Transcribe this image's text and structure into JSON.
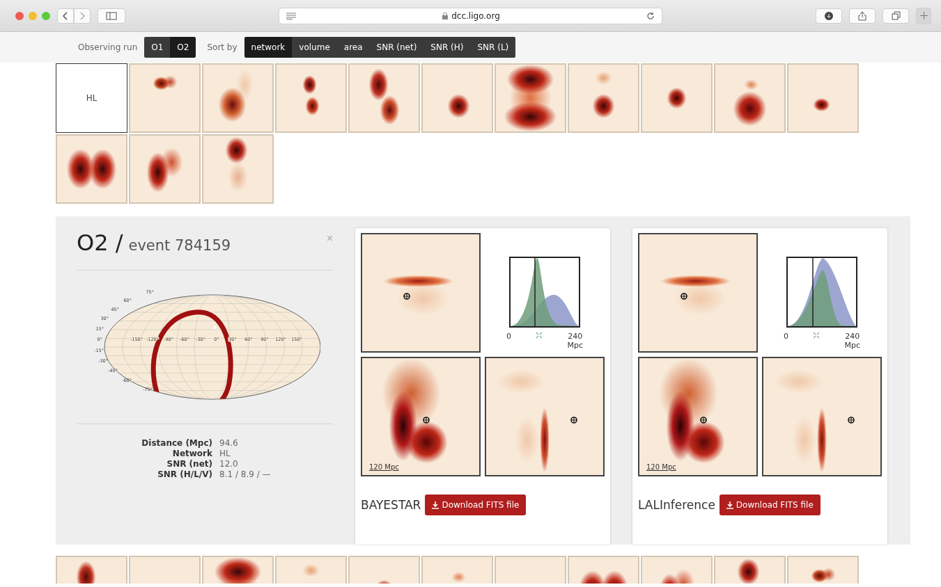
{
  "browser": {
    "url": "dcc.ligo.org"
  },
  "filters": {
    "run_label": "Observing run",
    "runs": [
      {
        "label": "O1",
        "selected": false
      },
      {
        "label": "O2",
        "selected": true
      }
    ],
    "sort_label": "Sort by",
    "sort_options": [
      {
        "label": "network",
        "selected": true
      },
      {
        "label": "volume",
        "selected": false
      },
      {
        "label": "area",
        "selected": false
      },
      {
        "label": "SNR (net)",
        "selected": false
      },
      {
        "label": "SNR (H)",
        "selected": false
      },
      {
        "label": "SNR (L)",
        "selected": false
      }
    ]
  },
  "thumbnails": [
    {
      "kind": "label",
      "text": "HL"
    },
    {
      "kind": "map"
    },
    {
      "kind": "map"
    },
    {
      "kind": "map"
    },
    {
      "kind": "map"
    },
    {
      "kind": "map"
    },
    {
      "kind": "map"
    },
    {
      "kind": "map"
    },
    {
      "kind": "map"
    },
    {
      "kind": "map"
    },
    {
      "kind": "map"
    },
    {
      "kind": "map"
    },
    {
      "kind": "map"
    },
    {
      "kind": "map"
    }
  ],
  "event": {
    "run": "O2 /",
    "name": "event 784159",
    "close": "×",
    "sky_map": {
      "lat_labels": [
        "75°",
        "60°",
        "45°",
        "30°",
        "15°",
        "0°",
        "-15°",
        "-30°",
        "-45°",
        "-60°",
        "-75°"
      ],
      "lon_labels": [
        "-150°",
        "-120°",
        "-90°",
        "-60°",
        "-30°",
        "0°",
        "30°",
        "60°",
        "90°",
        "120°",
        "150°"
      ]
    },
    "properties": [
      {
        "label": "Distance (Mpc)",
        "value": "94.6"
      },
      {
        "label": "Network",
        "value": "HL"
      },
      {
        "label": "SNR (net)",
        "value": "12.0"
      },
      {
        "label": "SNR (H/L/V)",
        "value": "8.1 / 8.9 / —"
      }
    ],
    "methods": [
      {
        "name": "BAYESTAR",
        "button": "Download FITS file",
        "axis_min": "0",
        "axis_max": "240",
        "axis_unit": "Mpc",
        "scale": "120 Mpc"
      },
      {
        "name": "LALInference",
        "button": "Download FITS file",
        "axis_min": "0",
        "axis_max": "240",
        "axis_unit": "Mpc",
        "scale": "120 Mpc"
      }
    ]
  },
  "more_thumbnails": [
    {
      "kind": "map"
    },
    {
      "kind": "map"
    },
    {
      "kind": "map"
    },
    {
      "kind": "map"
    },
    {
      "kind": "map"
    },
    {
      "kind": "map"
    },
    {
      "kind": "map"
    },
    {
      "kind": "map"
    },
    {
      "kind": "map"
    },
    {
      "kind": "map"
    },
    {
      "kind": "map"
    }
  ]
}
